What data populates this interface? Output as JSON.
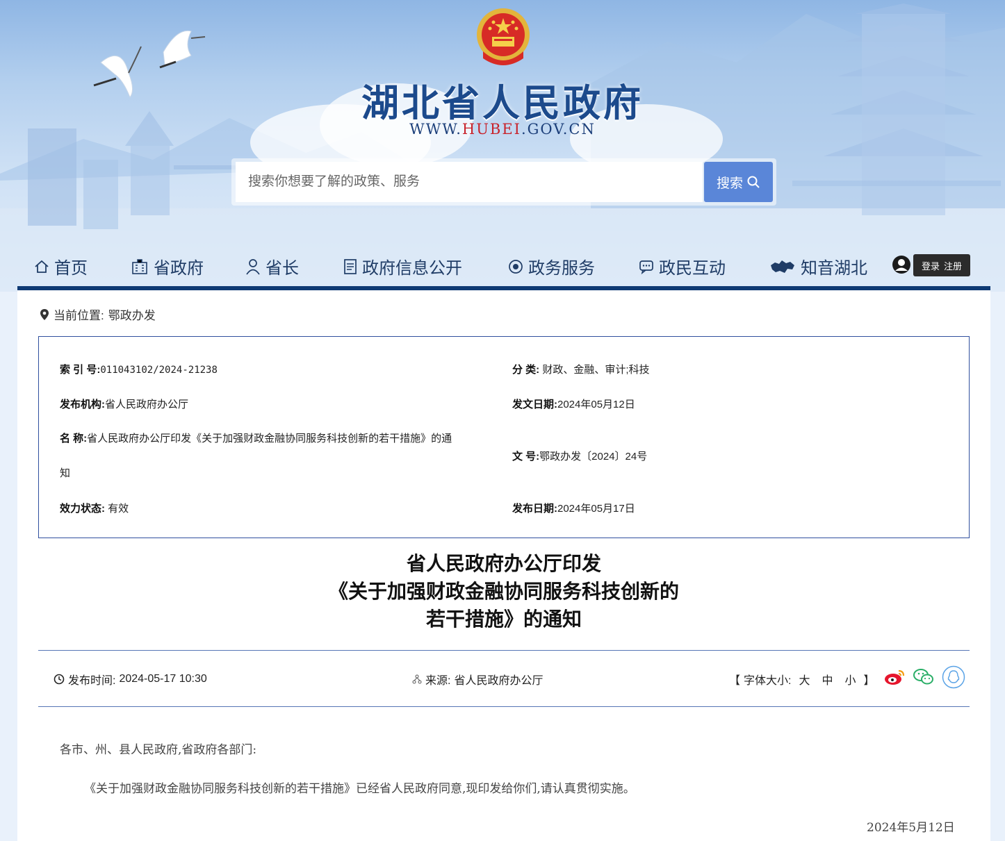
{
  "header": {
    "site_title": "湖北省人民政府",
    "site_url_prefix": "WWW.",
    "site_url_highlight": "HUBEI",
    "site_url_suffix": ".GOV.CN",
    "search": {
      "placeholder": "搜索你想要了解的政策、服务",
      "button_label": "搜索"
    }
  },
  "nav": {
    "items": [
      {
        "label": "首页",
        "icon": "home-icon"
      },
      {
        "label": "省政府",
        "icon": "building-icon"
      },
      {
        "label": "省长",
        "icon": "person-icon"
      },
      {
        "label": "政府信息公开",
        "icon": "document-icon"
      },
      {
        "label": "政务服务",
        "icon": "service-icon"
      },
      {
        "label": "政民互动",
        "icon": "chat-icon"
      },
      {
        "label": "知音湖北",
        "icon": "hubei-map-icon"
      }
    ],
    "login_label": "登录",
    "register_label": "注册"
  },
  "breadcrumb": {
    "prefix": "当前位置:",
    "current": "鄂政办发"
  },
  "meta": {
    "index_label": "索 引 号:",
    "index_value": "011043102/2024-21238",
    "category_label": "分 类:",
    "category_value": "财政、金融、审计;科技",
    "issuer_label": "发布机构:",
    "issuer_value": "省人民政府办公厅",
    "issue_date_label": "发文日期:",
    "issue_date_value": "2024年05月12日",
    "name_label": "名 称:",
    "name_value_line1": "省人民政府办公厅印发《关于加强财政金融协同服务科技创新的若干措施》的通",
    "name_value_line2": "知",
    "doc_no_label": "文 号:",
    "doc_no_value": "鄂政办发〔2024〕24号",
    "status_label": "效力状态:",
    "status_value": "有效",
    "publish_date_label": "发布日期:",
    "publish_date_value": "2024年05月17日"
  },
  "article": {
    "title_line1": "省人民政府办公厅印发",
    "title_line2": "《关于加强财政金融协同服务科技创新的",
    "title_line3": "若干措施》的通知",
    "publish_time_label": "发布时间:",
    "publish_time_value": "2024-05-17 10:30",
    "source_label": "来源:",
    "source_value": "省人民政府办公厅",
    "font_size_label": "字体大小:",
    "font_size_open": "【",
    "font_size_close": "】",
    "font_large": "大",
    "font_medium": "中",
    "font_small": "小",
    "salutation": "各市、州、县人民政府,省政府各部门:",
    "paragraph1": "《关于加强财政金融协同服务科技创新的若干措施》已经省人民政府同意,现印发给你们,请认真贯彻实施。",
    "date_sign": "2024年5月12日"
  },
  "colors": {
    "nav_bar": "#0e3a74",
    "title_blue": "#1c4a8c",
    "search_button": "#5a86d8",
    "box_border": "#2f4f9e"
  }
}
